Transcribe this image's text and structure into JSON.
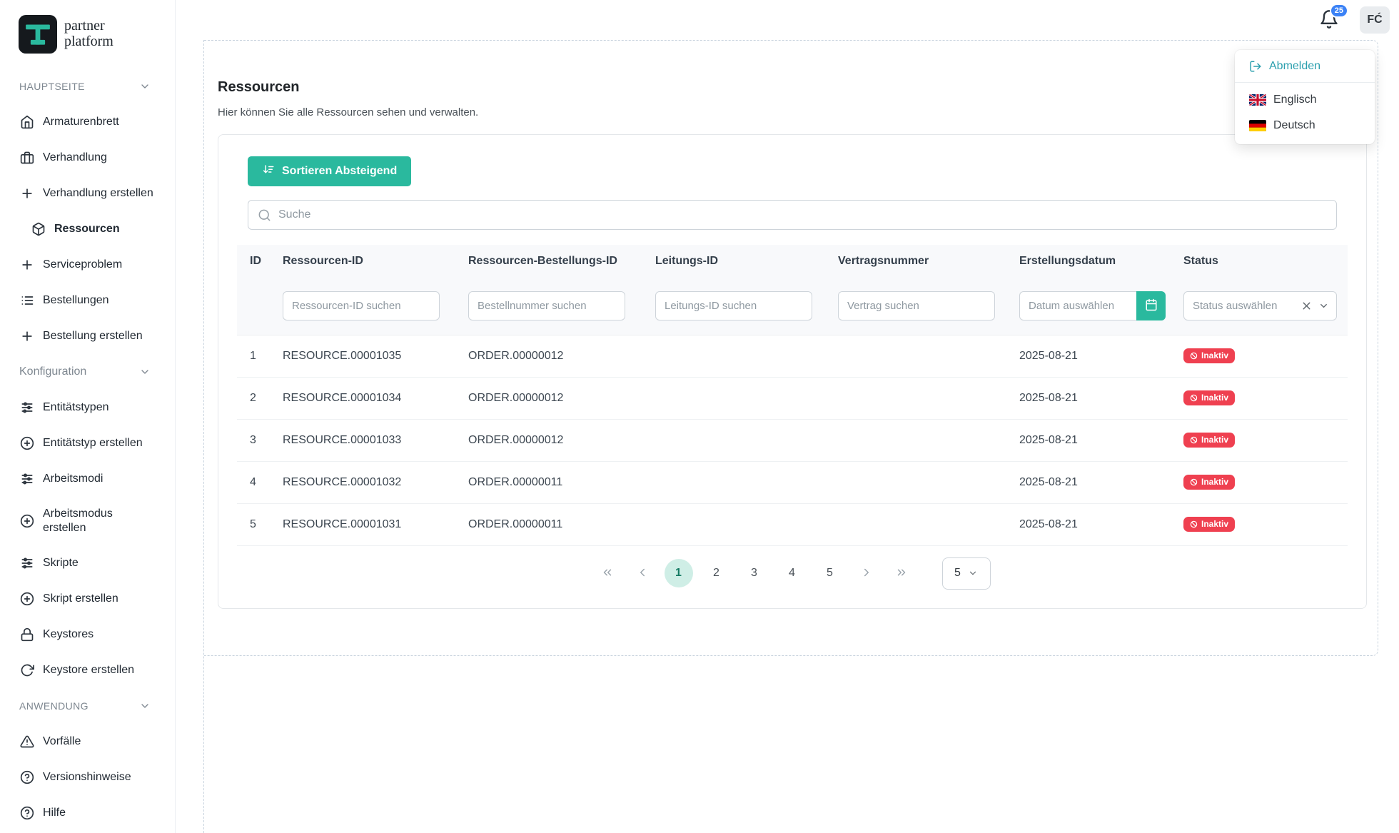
{
  "brand": {
    "line1": "partner",
    "line2": "platform"
  },
  "topbar": {
    "notification_count": "25",
    "avatar_initials": "FĆ",
    "bell_icon": "bell-icon"
  },
  "user_menu": {
    "logout_label": "Abmelden",
    "logout_icon": "logout-icon",
    "languages": [
      {
        "label": "Englisch",
        "flag": "flag-uk-icon"
      },
      {
        "label": "Deutsch",
        "flag": "flag-germany-icon"
      }
    ]
  },
  "sidebar": {
    "sections": [
      {
        "label": "HAUPTSEITE",
        "chevron": "chevron-down-icon",
        "items": [
          {
            "label": "Armaturenbrett",
            "icon": "home-icon"
          },
          {
            "label": "Verhandlung",
            "icon": "briefcase-icon"
          },
          {
            "label": "Verhandlung erstellen",
            "icon": "plus-icon"
          },
          {
            "label": "Ressourcen",
            "icon": "package-icon",
            "active": true
          },
          {
            "label": "Serviceproblem",
            "icon": "plus-icon"
          },
          {
            "label": "Bestellungen",
            "icon": "list-icon"
          },
          {
            "label": "Bestellung erstellen",
            "icon": "plus-icon"
          }
        ]
      },
      {
        "label": "Konfiguration",
        "chevron": "chevron-down-icon",
        "items": [
          {
            "label": "Entitätstypen",
            "icon": "sliders-icon"
          },
          {
            "label": "Entitätstyp erstellen",
            "icon": "plus-circle-icon"
          },
          {
            "label": "Arbeitsmodi",
            "icon": "sliders-icon"
          },
          {
            "label": "Arbeitsmodus erstellen",
            "icon": "plus-circle-icon"
          },
          {
            "label": "Skripte",
            "icon": "sliders-icon"
          },
          {
            "label": "Skript erstellen",
            "icon": "plus-circle-icon"
          },
          {
            "label": "Keystores",
            "icon": "lock-icon"
          },
          {
            "label": "Keystore erstellen",
            "icon": "rotate-icon"
          }
        ]
      },
      {
        "label": "ANWENDUNG",
        "chevron": "chevron-down-icon",
        "items": [
          {
            "label": "Vorfälle",
            "icon": "alert-triangle-icon"
          },
          {
            "label": "Versionshinweise",
            "icon": "help-circle-icon"
          },
          {
            "label": "Hilfe",
            "icon": "help-circle-icon"
          }
        ]
      }
    ]
  },
  "page": {
    "title": "Ressourcen",
    "subtitle": "Hier können Sie alle Ressourcen sehen und verwalten.",
    "sort_button_label": "Sortieren Absteigend",
    "search_placeholder": "Suche"
  },
  "table": {
    "columns": [
      "ID",
      "Ressourcen-ID",
      "Ressourcen-Bestellungs-ID",
      "Leitungs-ID",
      "Vertragsnummer",
      "Erstellungsdatum",
      "Status"
    ],
    "filters": {
      "resource_id_placeholder": "Ressourcen-ID suchen",
      "order_id_placeholder": "Bestellnummer suchen",
      "line_id_placeholder": "Leitungs-ID suchen",
      "contract_placeholder": "Vertrag suchen",
      "date_placeholder": "Datum auswählen",
      "status_placeholder": "Status auswählen"
    },
    "rows": [
      {
        "id": "1",
        "resource_id": "RESOURCE.00001035",
        "order_id": "ORDER.00000012",
        "line_id": "",
        "contract": "",
        "created": "2025-08-21",
        "status": "Inaktiv"
      },
      {
        "id": "2",
        "resource_id": "RESOURCE.00001034",
        "order_id": "ORDER.00000012",
        "line_id": "",
        "contract": "",
        "created": "2025-08-21",
        "status": "Inaktiv"
      },
      {
        "id": "3",
        "resource_id": "RESOURCE.00001033",
        "order_id": "ORDER.00000012",
        "line_id": "",
        "contract": "",
        "created": "2025-08-21",
        "status": "Inaktiv"
      },
      {
        "id": "4",
        "resource_id": "RESOURCE.00001032",
        "order_id": "ORDER.00000011",
        "line_id": "",
        "contract": "",
        "created": "2025-08-21",
        "status": "Inaktiv"
      },
      {
        "id": "5",
        "resource_id": "RESOURCE.00001031",
        "order_id": "ORDER.00000011",
        "line_id": "",
        "contract": "",
        "created": "2025-08-21",
        "status": "Inaktiv"
      }
    ]
  },
  "pagination": {
    "controls": {
      "first": "chevrons-left-icon",
      "prev": "chevron-left-icon",
      "next": "chevron-right-icon",
      "last": "chevrons-right-icon"
    },
    "pages": [
      "1",
      "2",
      "3",
      "4",
      "5"
    ],
    "active_page": "1",
    "page_size": "5"
  },
  "colors": {
    "accent": "#2ab99e",
    "badge_red": "#ef4050",
    "notification_blue": "#3b82f6",
    "active_page_bg": "#cfeee6"
  }
}
